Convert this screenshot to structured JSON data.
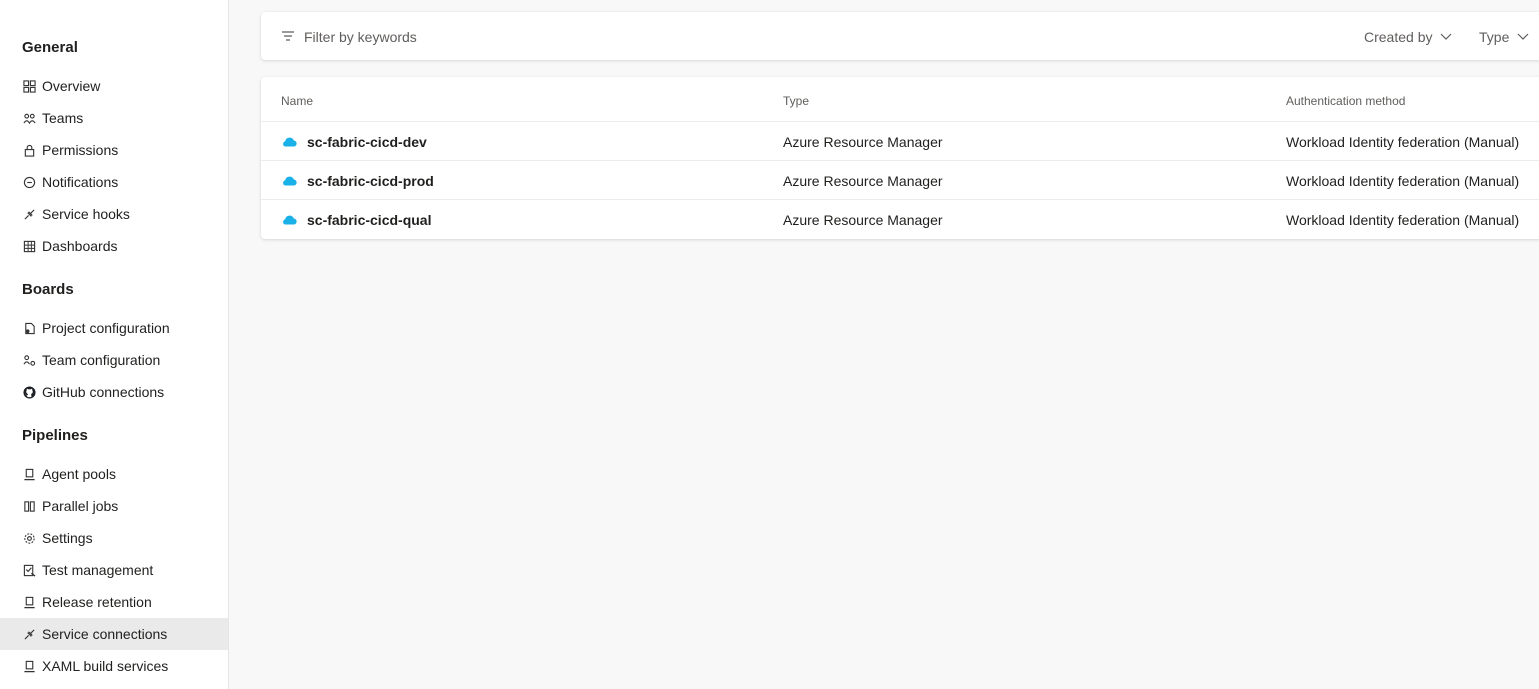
{
  "sidebar": {
    "sections": [
      {
        "title": "General"
      },
      {
        "title": "Boards"
      },
      {
        "title": "Pipelines"
      }
    ],
    "general_items": [
      {
        "label": "Overview",
        "icon": "overview-icon"
      },
      {
        "label": "Teams",
        "icon": "teams-icon"
      },
      {
        "label": "Permissions",
        "icon": "lock-icon"
      },
      {
        "label": "Notifications",
        "icon": "chat-bubble-icon"
      },
      {
        "label": "Service hooks",
        "icon": "plug-icon"
      },
      {
        "label": "Dashboards",
        "icon": "grid-icon"
      }
    ],
    "boards_items": [
      {
        "label": "Project configuration",
        "icon": "doc-gear-icon"
      },
      {
        "label": "Team configuration",
        "icon": "people-gear-icon"
      },
      {
        "label": "GitHub connections",
        "icon": "github-icon"
      }
    ],
    "pipelines_items": [
      {
        "label": "Agent pools",
        "icon": "agent-icon"
      },
      {
        "label": "Parallel jobs",
        "icon": "parallel-icon"
      },
      {
        "label": "Settings",
        "icon": "gear-icon"
      },
      {
        "label": "Test management",
        "icon": "checklist-icon"
      },
      {
        "label": "Release retention",
        "icon": "agent-icon"
      },
      {
        "label": "Service connections",
        "icon": "plug-icon",
        "selected": true
      },
      {
        "label": "XAML build services",
        "icon": "agent-icon"
      }
    ]
  },
  "filter": {
    "placeholder": "Filter by keywords",
    "created_by_label": "Created by",
    "type_label": "Type"
  },
  "table": {
    "columns": [
      "Name",
      "Type",
      "Authentication method"
    ],
    "rows": [
      {
        "name": "sc-fabric-cicd-dev",
        "type": "Azure Resource Manager",
        "auth": "Workload Identity federation (Manual)"
      },
      {
        "name": "sc-fabric-cicd-prod",
        "type": "Azure Resource Manager",
        "auth": "Workload Identity federation (Manual)"
      },
      {
        "name": "sc-fabric-cicd-qual",
        "type": "Azure Resource Manager",
        "auth": "Workload Identity federation (Manual)"
      }
    ]
  },
  "colors": {
    "cloud": "#1ab0e8",
    "selected_bg": "#eaeaea"
  }
}
